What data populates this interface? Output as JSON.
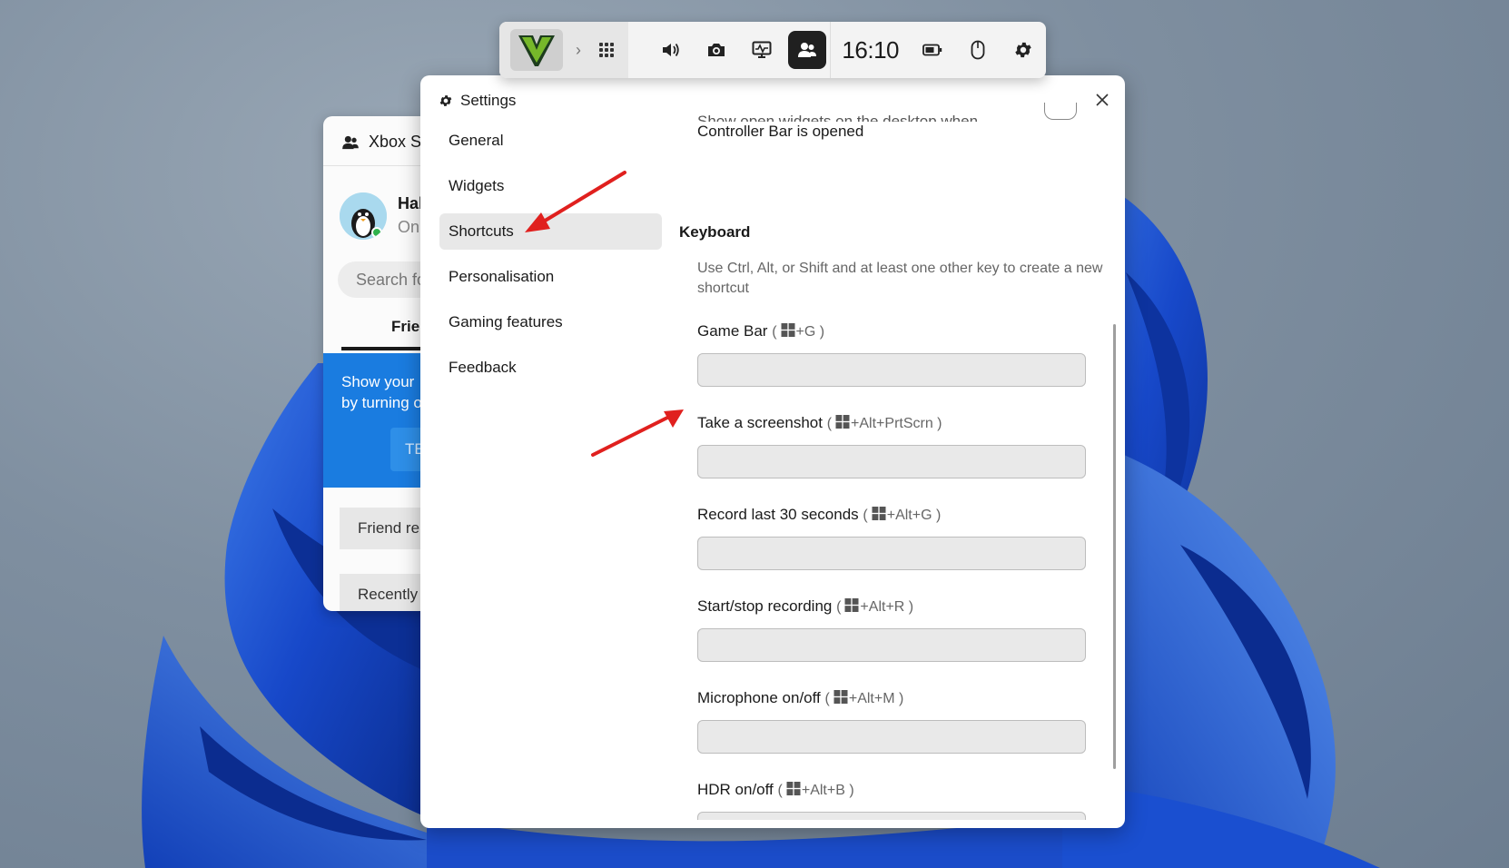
{
  "gamebar": {
    "time": "16:10",
    "icons": [
      "game-logo",
      "chevron-right-icon",
      "widget-menu-icon",
      "volume-icon",
      "camera-icon",
      "performance-icon",
      "social-icon",
      "battery-icon",
      "mouse-icon",
      "settings-icon"
    ]
  },
  "xbox_social": {
    "title": "Xbox Sc",
    "user_name": "Hal",
    "user_status": "On",
    "search_placeholder": "Search fo",
    "tab_label": "Frier",
    "promo_line1": "Show your",
    "promo_line2": "by turning o",
    "promo_button": "TE",
    "row1": "Friend re",
    "row2": "Recently"
  },
  "settings": {
    "title": "Settings",
    "nav": [
      "General",
      "Widgets",
      "Shortcuts",
      "Personalisation",
      "Gaming features",
      "Feedback"
    ],
    "active_nav": "Shortcuts",
    "clipped_text": "Show open widgets on the desktop when",
    "clipped_text_line2": "Controller Bar is opened",
    "keyboard_title": "Keyboard",
    "keyboard_desc": "Use Ctrl, Alt, or Shift and at least one other key to create a new shortcut",
    "shortcuts": [
      {
        "label": "Game Bar",
        "hint": "+G )"
      },
      {
        "label": "Take a screenshot",
        "hint": "+Alt+PrtScrn )"
      },
      {
        "label": "Record last 30 seconds",
        "hint": "+Alt+G )"
      },
      {
        "label": "Start/stop recording",
        "hint": "+Alt+R )"
      },
      {
        "label": "Microphone on/off",
        "hint": "+Alt+M )"
      },
      {
        "label": "HDR on/off",
        "hint": "+Alt+B )"
      }
    ],
    "hint_open": "("
  },
  "colors": {
    "accent_blue": "#1a7ce0",
    "annotation_red": "#e0201e",
    "wallpaper_blue": "#1747c8"
  }
}
